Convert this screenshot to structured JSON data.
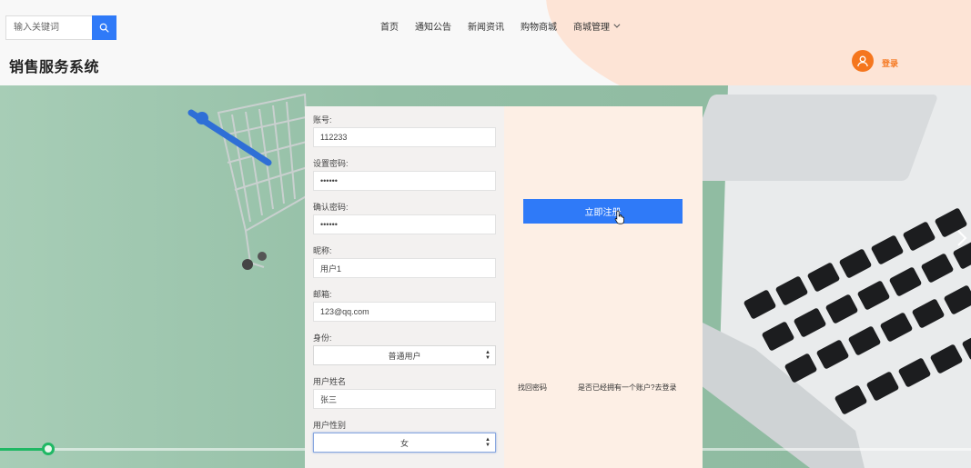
{
  "header": {
    "search": {
      "placeholder": "输入关键词"
    },
    "nav": [
      {
        "label": "首页"
      },
      {
        "label": "通知公告"
      },
      {
        "label": "新闻资讯"
      },
      {
        "label": "购物商城"
      },
      {
        "label": "商城管理"
      }
    ],
    "site_title": "销售服务系统",
    "login_label": "登录",
    "colors": {
      "accent": "#2f7af8",
      "orange": "#f5761e",
      "peach": "#fde4d6"
    }
  },
  "form": {
    "fields": [
      {
        "label": "账号:",
        "value": "112233"
      },
      {
        "label": "设置密码:",
        "value": "••••••"
      },
      {
        "label": "确认密码:",
        "value": "••••••"
      },
      {
        "label": "昵称:",
        "value": "用户1"
      },
      {
        "label": "邮箱:",
        "value": "123@qq.com"
      }
    ],
    "role": {
      "label": "身份:",
      "value": "普通用户"
    },
    "real_name": {
      "label": "用户姓名",
      "value": "张三"
    },
    "gender": {
      "label": "用户性别",
      "value": "女"
    },
    "register_label": "立即注册",
    "forgot_label": "找回密码",
    "have_account_label": "是否已经拥有一个账户?去登录"
  },
  "banner": {
    "progress": 0.05,
    "icons": {
      "next": "chevron-right-icon",
      "search": "search-icon",
      "avatar": "user-icon"
    }
  }
}
